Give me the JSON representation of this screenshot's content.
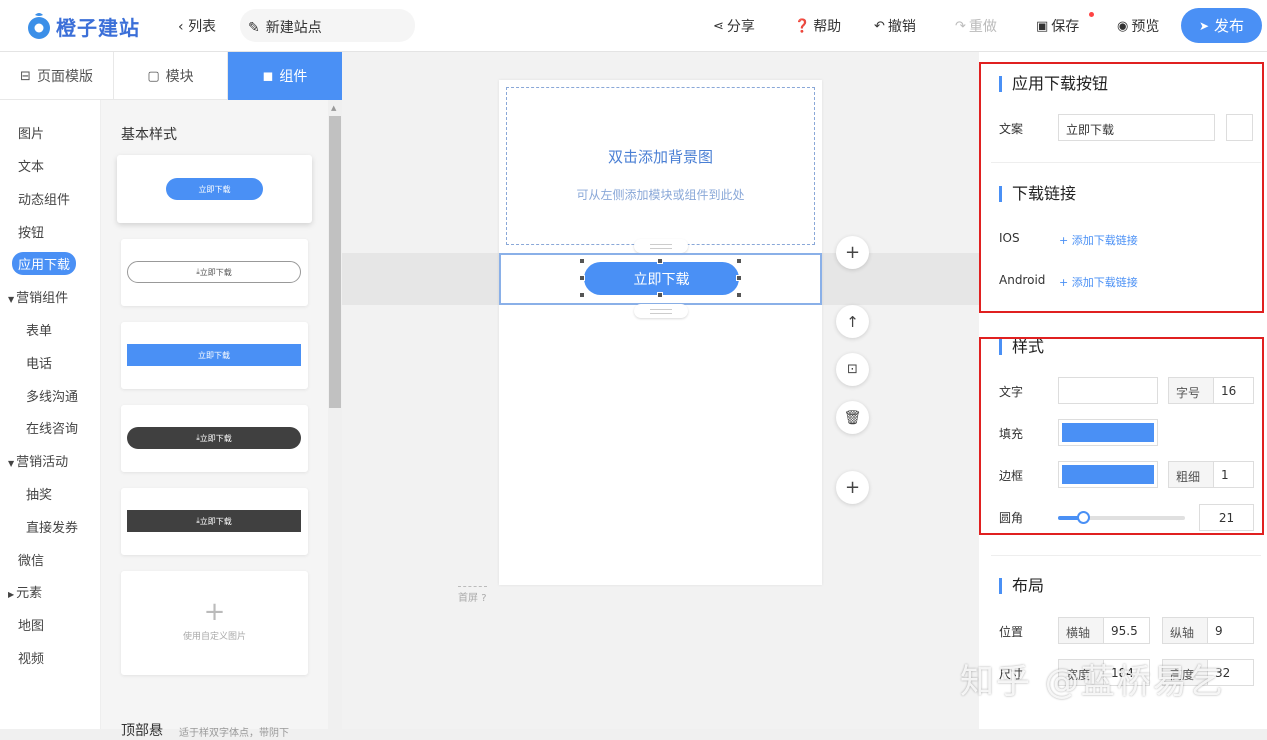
{
  "app": {
    "logo_text": "橙子建站",
    "brand_color": "#4a90f5"
  },
  "topbar": {
    "back": "列表",
    "site_name": "新建站点",
    "share": "分享",
    "help": "帮助",
    "undo": "撤销",
    "redo": "重做",
    "save": "保存",
    "preview": "预览",
    "publish": "发布"
  },
  "tabs": [
    {
      "label": "页面模版"
    },
    {
      "label": "模块"
    },
    {
      "label": "组件"
    }
  ],
  "categories": [
    "图片",
    "文本",
    "动态组件",
    "按钮",
    "应用下载",
    "营销组件",
    "表单",
    "电话",
    "多线沟通",
    "在线咨询",
    "营销活动",
    "抽奖",
    "直接发券",
    "微信",
    "元素",
    "地图",
    "视频"
  ],
  "library": {
    "heading": "基本样式",
    "cards": [
      {
        "label": "立即下载"
      },
      {
        "label": "立即下载"
      },
      {
        "label": "立即下载"
      },
      {
        "label": "立即下载"
      },
      {
        "label": "立即下载"
      }
    ],
    "custom_label": "使用自定义图片",
    "bottom_heading": "顶部悬",
    "bottom_note": "适于样双字体点，带阴下"
  },
  "canvas": {
    "bg_title": "双击添加背景图",
    "bg_hint": "可从左侧添加模块或组件到此处",
    "button_text": "立即下载",
    "fold_label": "首屏"
  },
  "panel": {
    "app_download": {
      "title": "应用下载按钮",
      "text_label": "文案",
      "text_value": "立即下载"
    },
    "links": {
      "title": "下载链接",
      "ios_label": "IOS",
      "android_label": "Android",
      "add_link": "+ 添加下载链接"
    },
    "style": {
      "title": "样式",
      "text_label": "文字",
      "font_size_label": "字号",
      "font_size": "16",
      "fill_label": "填充",
      "border_label": "边框",
      "border_width_label": "粗细",
      "border_width": "1",
      "radius_label": "圆角",
      "radius": "21",
      "radius_fraction": 0.2
    },
    "layout": {
      "title": "布局",
      "position_label": "位置",
      "x_label": "横轴",
      "x_value": "95.5",
      "y_label": "纵轴",
      "y_value": "9",
      "size_label": "尺寸",
      "w_label": "宽度",
      "w_value": "184",
      "h_label": "高度",
      "h_value": "32"
    }
  },
  "watermark": "知乎 @蓝桥易乞"
}
